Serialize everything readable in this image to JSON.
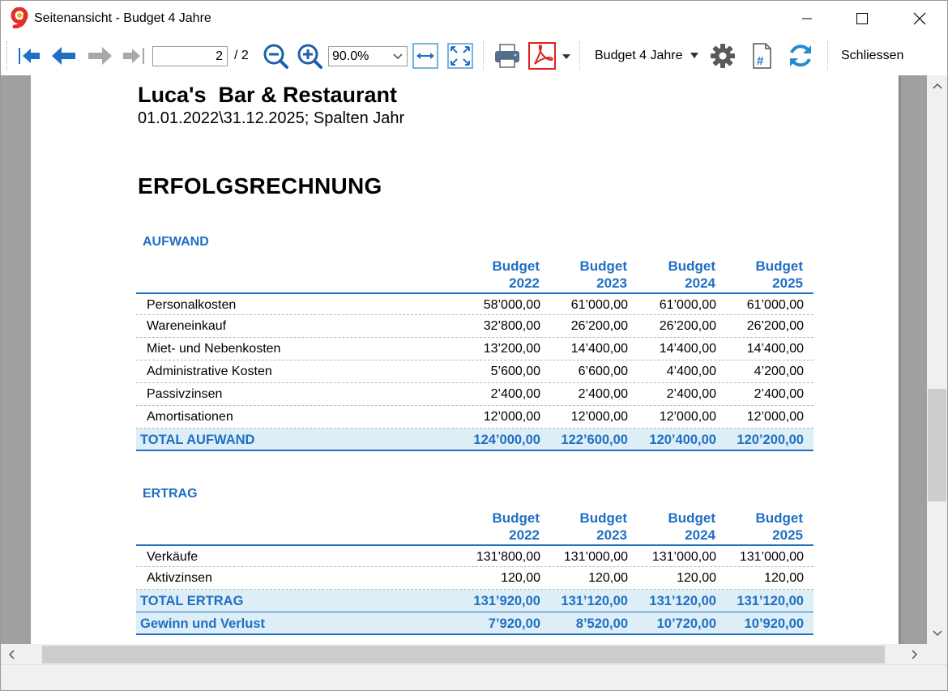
{
  "window": {
    "title": "Seitenansicht - Budget 4 Jahre"
  },
  "toolbar": {
    "page_current": "2",
    "page_total": "/ 2",
    "zoom": "90.0%",
    "report_selector": "Budget 4 Jahre",
    "close_label": "Schliessen"
  },
  "colors": {
    "accent_blue": "#1f6fc4",
    "total_row_bg": "#deeef7",
    "pdf_red": "#e02020"
  },
  "report": {
    "company": "Luca's  Bar & Restaurant",
    "period": "01.01.2022\\31.12.2025; Spalten Jahr",
    "title": "ERFOLGSRECHNUNG",
    "columns": [
      {
        "line1": "Budget",
        "line2": "2022"
      },
      {
        "line1": "Budget",
        "line2": "2023"
      },
      {
        "line1": "Budget",
        "line2": "2024"
      },
      {
        "line1": "Budget",
        "line2": "2025"
      }
    ],
    "aufwand": {
      "title": "AUFWAND",
      "rows": [
        {
          "label": "Personalkosten",
          "values": [
            "58’000,00",
            "61’000,00",
            "61’000,00",
            "61’000,00"
          ]
        },
        {
          "label": "Wareneinkauf",
          "values": [
            "32’800,00",
            "26’200,00",
            "26’200,00",
            "26’200,00"
          ]
        },
        {
          "label": "Miet- und Nebenkosten",
          "values": [
            "13’200,00",
            "14’400,00",
            "14’400,00",
            "14’400,00"
          ]
        },
        {
          "label": "Administrative Kosten",
          "values": [
            "5’600,00",
            "6’600,00",
            "4’400,00",
            "4’200,00"
          ]
        },
        {
          "label": "Passivzinsen",
          "values": [
            "2’400,00",
            "2’400,00",
            "2’400,00",
            "2’400,00"
          ]
        },
        {
          "label": "Amortisationen",
          "values": [
            "12’000,00",
            "12’000,00",
            "12’000,00",
            "12’000,00"
          ]
        }
      ],
      "total": {
        "label": "TOTAL AUFWAND",
        "values": [
          "124’000,00",
          "122’600,00",
          "120’400,00",
          "120’200,00"
        ]
      }
    },
    "ertrag": {
      "title": "ERTRAG",
      "rows": [
        {
          "label": "Verkäufe",
          "values": [
            "131’800,00",
            "131’000,00",
            "131’000,00",
            "131’000,00"
          ]
        },
        {
          "label": "Aktivzinsen",
          "values": [
            "120,00",
            "120,00",
            "120,00",
            "120,00"
          ]
        }
      ],
      "total": {
        "label": "TOTAL ERTRAG",
        "values": [
          "131’920,00",
          "131’120,00",
          "131’120,00",
          "131’120,00"
        ]
      },
      "result": {
        "label": "Gewinn und Verlust",
        "values": [
          "7’920,00",
          "8’520,00",
          "10’720,00",
          "10’920,00"
        ]
      }
    }
  }
}
